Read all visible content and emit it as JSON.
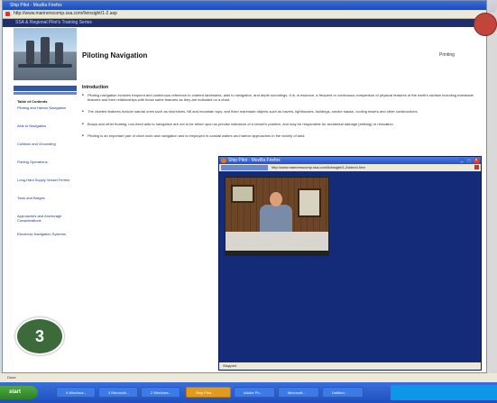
{
  "browser": {
    "title": "Ship Pilot - Mozilla Firefox",
    "address": "http://www.marinerscomp.ssa.com/livinsight/1-2.asp",
    "banner": "SSA & Regional Pilot's Training Series",
    "status": "Done"
  },
  "sidebar": {
    "items": [
      {
        "label": "Table of Contents"
      },
      {
        "label": "Piloting and Harbor Navigation"
      },
      {
        "label": "Aids to Navigation"
      },
      {
        "label": "Collision and Grounding"
      },
      {
        "label": "Fishing Operations"
      },
      {
        "label": "Long-Haul Supply Vessel Ferries"
      },
      {
        "label": "Tows and Barges"
      },
      {
        "label": "Approaches and Anchorage Considerations"
      },
      {
        "label": "Electronic Navigation Systems"
      }
    ]
  },
  "page": {
    "title": "Piloting Navigation",
    "printing_label": "Printing",
    "section_title": "Introduction",
    "bullets": [
      "Piloting navigation involves frequent and continuous reference to charted landmarks, aids to navigation, and depth soundings. It is, in essence, a frequent or continuous comparison of physical features of the earth's surface including manmade features and their relationships with those same features as they are indicated on a chart.",
      "The charted features include natural ones such as shorelines, hill and mountain tops, and fixed manmade objects such as towers, lighthouses, buildings, smoke stacks, cooling towers and other constructions.",
      "Buoys and other floating, non-fixed aids to navigation are not to be relied upon as precise indicators of a vessel's position, and may be responsible for accidental damage (striking) or relocation.",
      "Piloting is an important part of chart work and navigation and is employed in coastal waters and harbor approaches in the vicinity of land."
    ]
  },
  "popup": {
    "title": "Ship Pilot - Mozilla Firefox",
    "address": "http://www.marinerscomp.ssa.com/livinsight/1-2video1.htm",
    "status": "Stopped"
  },
  "badge": {
    "number": "3"
  },
  "taskbar": {
    "start_label": "start",
    "tasks": [
      {
        "label": "4 Windows..."
      },
      {
        "label": "3 Microsoft..."
      },
      {
        "label": "2 Windows..."
      },
      {
        "label": "Ship Pilot..."
      },
      {
        "label": "Adobe Ph..."
      },
      {
        "label": "Microsoft..."
      },
      {
        "label": "Untitled..."
      }
    ]
  }
}
